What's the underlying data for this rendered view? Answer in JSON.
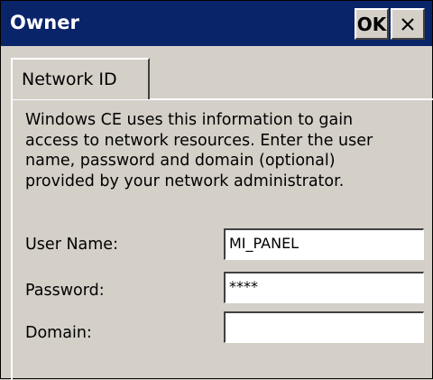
{
  "window": {
    "title": "Owner",
    "ok_label": "OK",
    "close_glyph": "✕"
  },
  "tabs": [
    {
      "label": "Network ID",
      "selected": true
    }
  ],
  "description_lines": [
    "Windows CE uses this information to gain",
    "access to network resources. Enter the user",
    "name, password and domain (optional)",
    "provided by your network administrator."
  ],
  "form": {
    "username": {
      "label": "User Name:",
      "value": "MI_PANEL"
    },
    "password": {
      "label": "Password:",
      "value": "****"
    },
    "domain": {
      "label": "Domain:",
      "value": ""
    }
  },
  "colors": {
    "titlebar": "#0a246a",
    "face": "#d4d0c8"
  }
}
